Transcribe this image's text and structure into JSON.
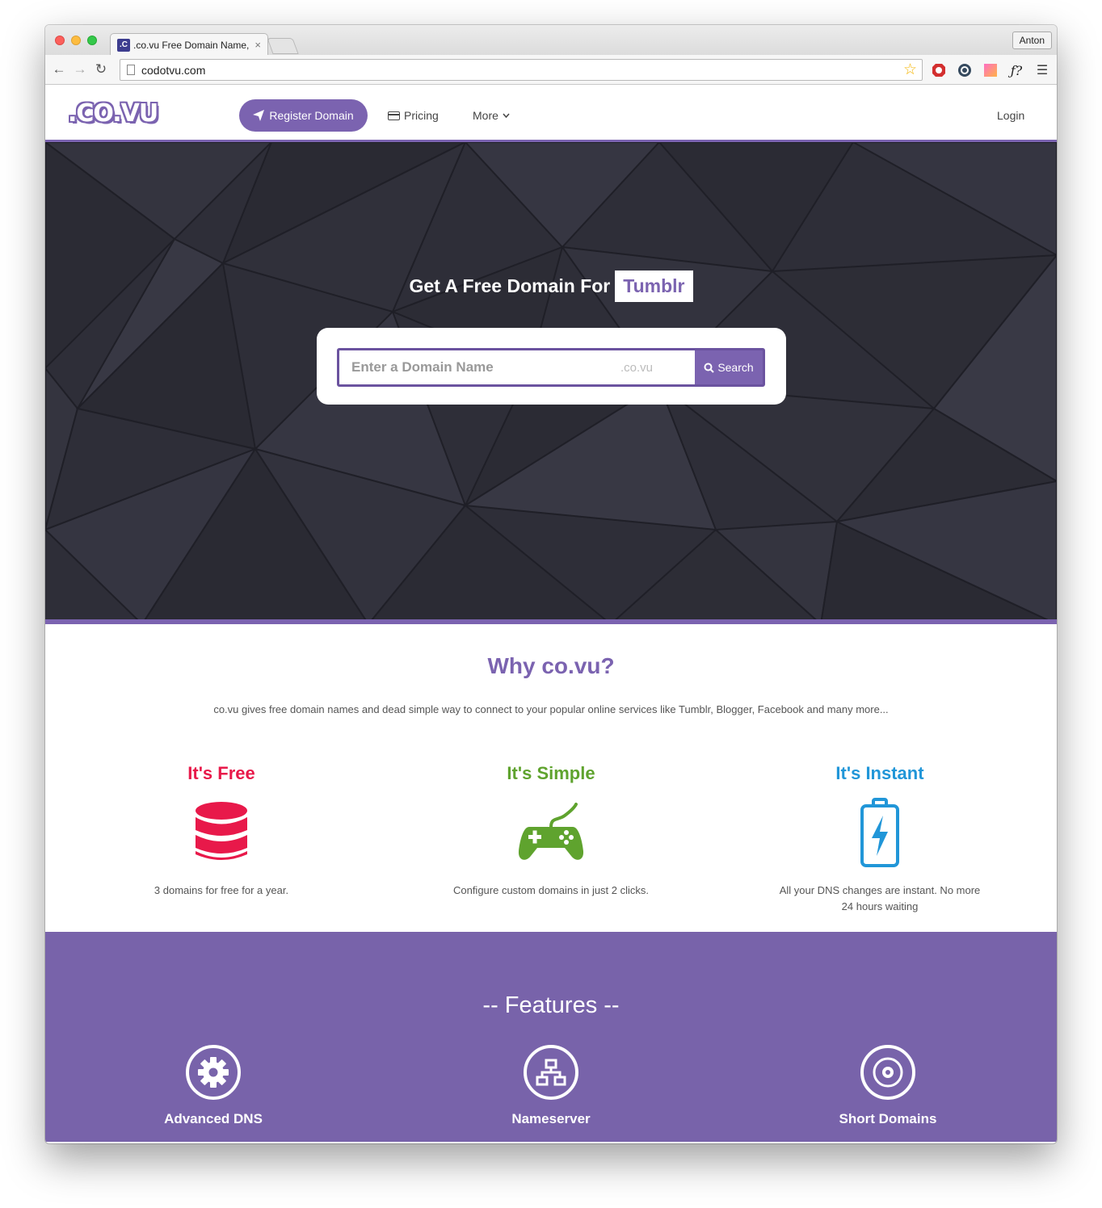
{
  "browser": {
    "tab_title": ".co.vu Free Domain Name, F",
    "tab_favicon": ".C",
    "close_glyph": "×",
    "profile": "Anton",
    "url": "codotvu.com"
  },
  "nav": {
    "logo": ".CO.VU",
    "register": "Register Domain",
    "pricing": "Pricing",
    "more": "More",
    "login": "Login"
  },
  "hero": {
    "title": "Get A Free Domain For",
    "highlight": "Tumblr",
    "placeholder": "Enter a Domain Name",
    "tld": ".co.vu",
    "search": "Search"
  },
  "why": {
    "title": "Why co.vu?",
    "subtitle": "co.vu gives free domain names and dead simple way to connect to your popular online services like Tumblr, Blogger, Facebook and many more...",
    "items": [
      {
        "title": "It's Free",
        "desc": "3 domains for free for a year.",
        "color": "#e8194a",
        "icon": "database-icon"
      },
      {
        "title": "It's Simple",
        "desc": "Configure custom domains in just 2 clicks.",
        "color": "#5fa32e",
        "icon": "gamepad-icon"
      },
      {
        "title": "It's Instant",
        "desc": "All your DNS changes are instant. No more 24 hours waiting",
        "color": "#2196d8",
        "icon": "battery-bolt-icon"
      }
    ]
  },
  "features": {
    "title": "-- Features --",
    "items": [
      {
        "title": "Advanced DNS",
        "icon": "gear-icon"
      },
      {
        "title": "Nameserver",
        "icon": "sitemap-icon"
      },
      {
        "title": "Short Domains",
        "icon": "disc-icon"
      }
    ]
  },
  "colors": {
    "brand": "#7b63b0",
    "features_bg": "#7863aa",
    "hero_bg": "#2e2e38"
  }
}
